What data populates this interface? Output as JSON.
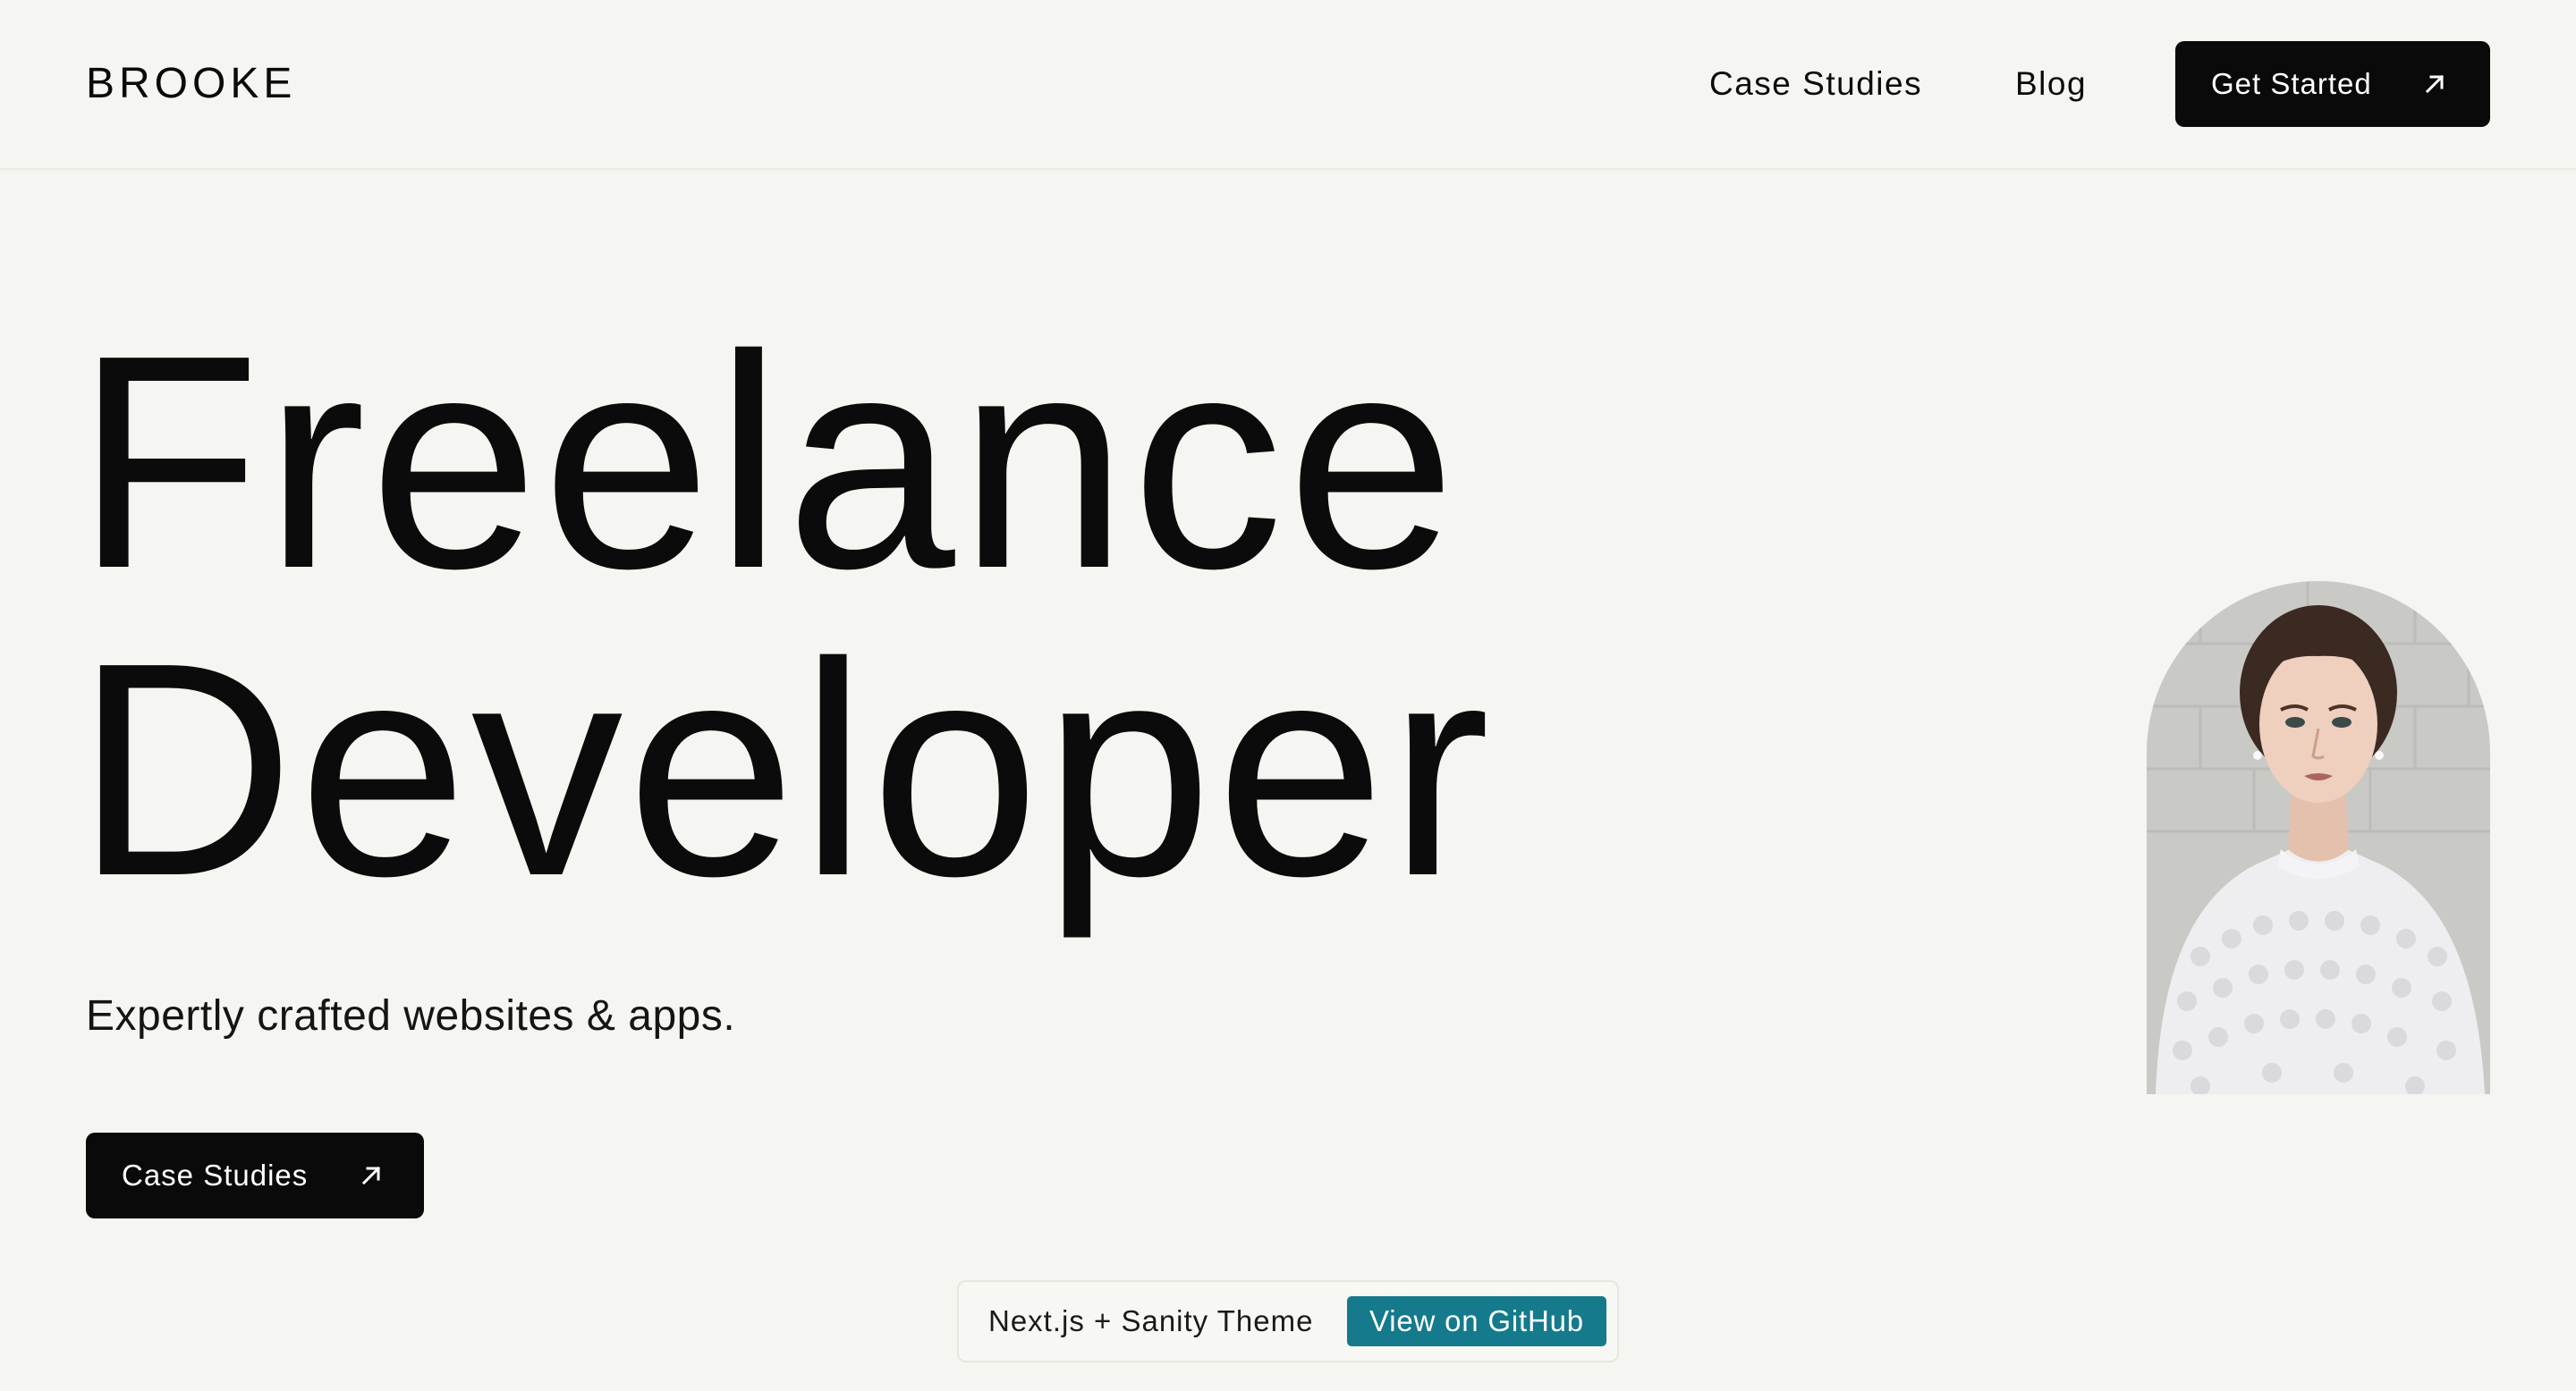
{
  "header": {
    "brand": "BROOKE",
    "nav": [
      {
        "label": "Case Studies"
      },
      {
        "label": "Blog"
      }
    ],
    "cta": {
      "label": "Get Started",
      "icon": "arrow-up-right-icon"
    }
  },
  "hero": {
    "title_lines": [
      "Freelance",
      "Developer"
    ],
    "subtitle": "Expertly crafted websites & apps.",
    "cta": {
      "label": "Case Studies",
      "icon": "arrow-up-right-icon"
    },
    "portrait_alt": "Portrait of Brooke"
  },
  "theme_banner": {
    "text": "Next.js + Sanity Theme",
    "link_label": "View on GitHub"
  },
  "colors": {
    "background": "#f5f5f1",
    "text": "#0b0b0b",
    "button": "#0a0a0a",
    "accent": "#147a8c"
  }
}
